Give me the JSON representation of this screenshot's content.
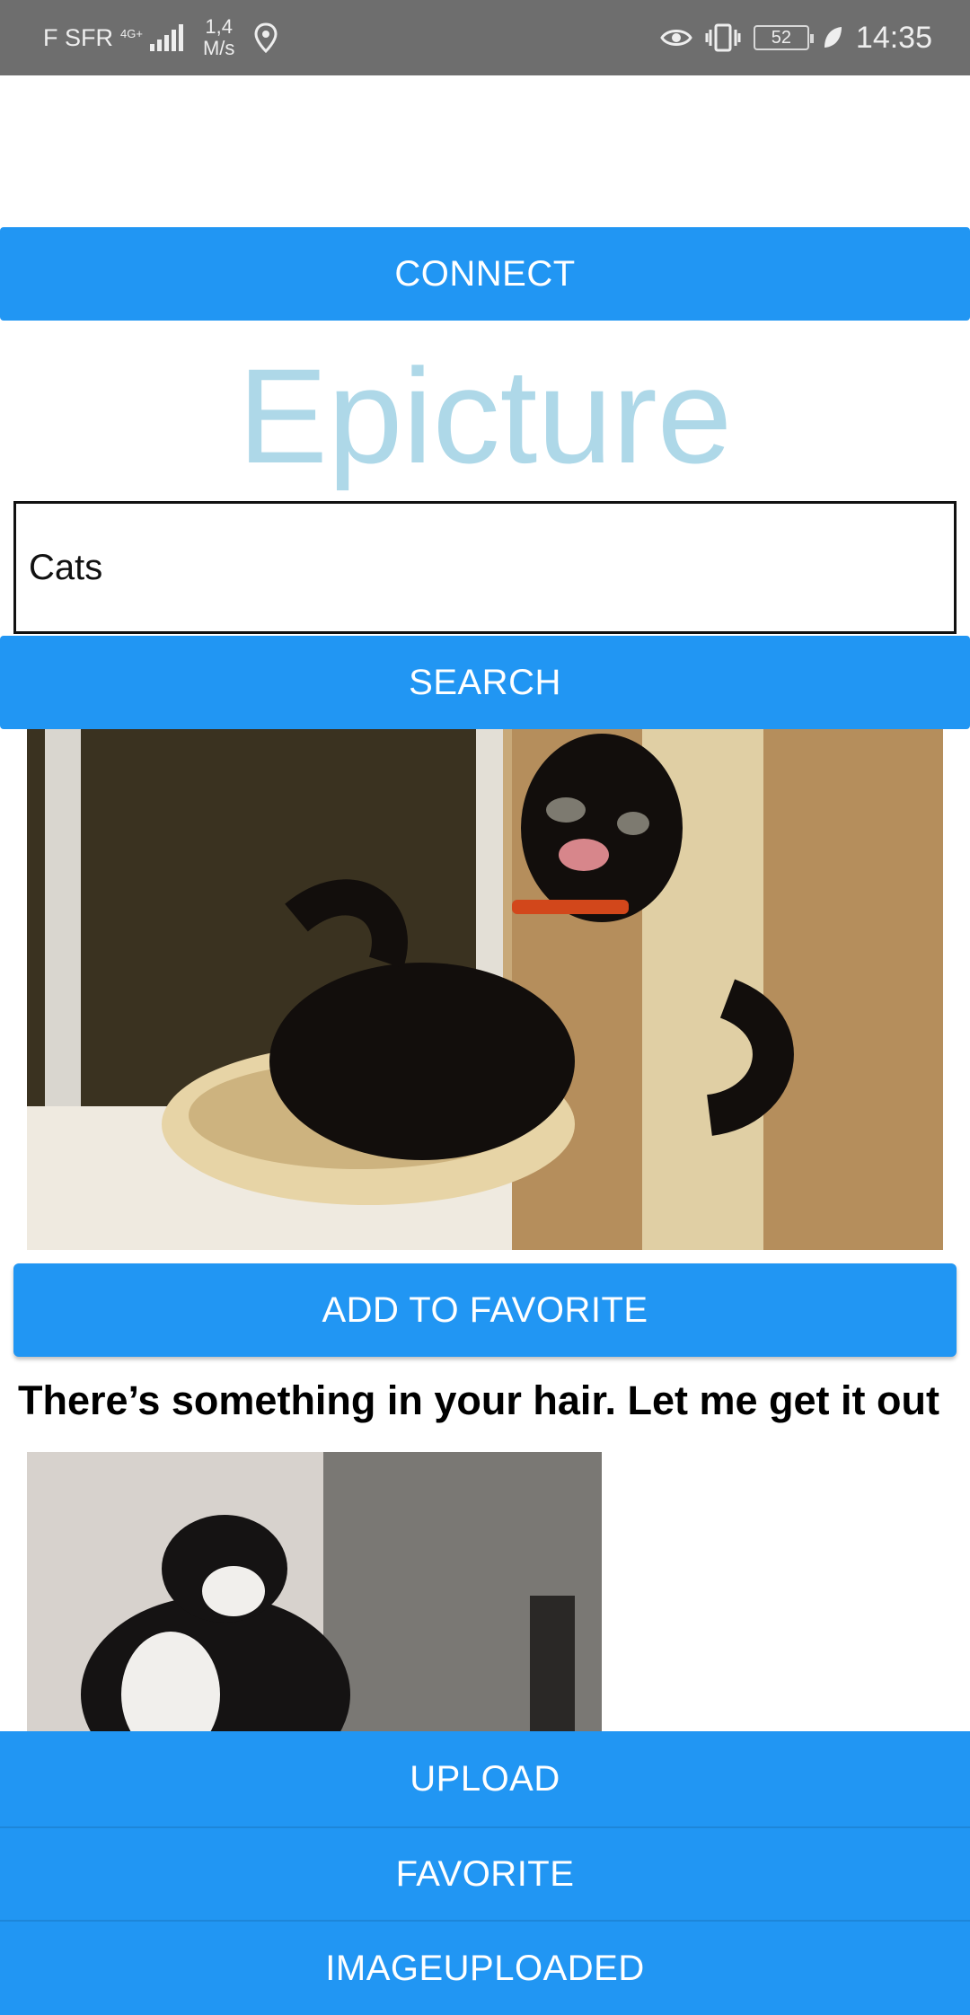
{
  "status_bar": {
    "carrier": "F SFR",
    "network": "4G+",
    "speed_value": "1,4",
    "speed_unit": "M/s",
    "battery": "52",
    "time": "14:35",
    "icons": [
      "signal-icon",
      "location-icon",
      "eye-icon",
      "vibrate-icon",
      "battery-icon",
      "leaf-icon"
    ]
  },
  "header": {
    "connect_label": "CONNECT",
    "app_title": "Epicture"
  },
  "search": {
    "value": "Cats",
    "button_label": "SEARCH"
  },
  "results": [
    {
      "add_favorite_label": "ADD TO FAVORITE",
      "caption": "There’s something in your hair. Let me get it out"
    }
  ],
  "bottom_nav": {
    "upload_label": "UPLOAD",
    "favorite_label": "FAVORITE",
    "imageuploaded_label": "IMAGEUPLOADED"
  },
  "colors": {
    "primary": "#2196f3",
    "title": "#aed8e8",
    "status_bar": "#6e6e6e"
  }
}
